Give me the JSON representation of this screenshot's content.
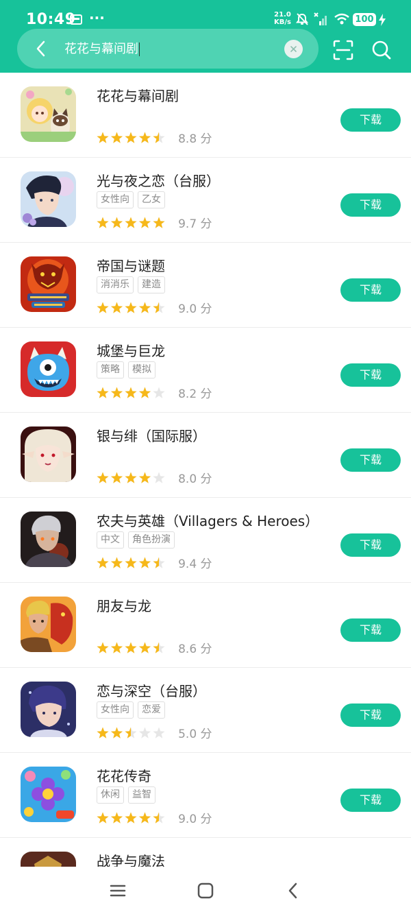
{
  "status_bar": {
    "time": "10:49",
    "more": "···",
    "net_speed_value": "21.0",
    "net_speed_unit": "KB/s",
    "battery": "100"
  },
  "search": {
    "query": "花花与幕间剧"
  },
  "colors": {
    "accent": "#17c29a",
    "search_pill": "#4fd3b3",
    "star_filled": "#f6b81a",
    "star_empty": "#e6e6e6"
  },
  "download_label": "下载",
  "score_unit": "分",
  "apps": [
    {
      "name": "花花与幕间剧",
      "tags": [],
      "rating": 4.5,
      "score": "8.8"
    },
    {
      "name": "光与夜之恋（台服）",
      "tags": [
        "女性向",
        "乙女"
      ],
      "rating": 5,
      "score": "9.7"
    },
    {
      "name": "帝国与谜题",
      "tags": [
        "消消乐",
        "建造"
      ],
      "rating": 4.5,
      "score": "9.0"
    },
    {
      "name": "城堡与巨龙",
      "tags": [
        "策略",
        "模拟"
      ],
      "rating": 4,
      "score": "8.2"
    },
    {
      "name": "银与绯（国际服）",
      "tags": [],
      "rating": 4,
      "score": "8.0"
    },
    {
      "name": "农夫与英雄（Villagers & Heroes）",
      "tags": [
        "中文",
        "角色扮演"
      ],
      "rating": 4.5,
      "score": "9.4"
    },
    {
      "name": "朋友与龙",
      "tags": [],
      "rating": 4.5,
      "score": "8.6"
    },
    {
      "name": "恋与深空（台服）",
      "tags": [
        "女性向",
        "恋爱"
      ],
      "rating": 2.5,
      "score": "5.0"
    },
    {
      "name": "花花传奇",
      "tags": [
        "休闲",
        "益智"
      ],
      "rating": 4.5,
      "score": "9.0"
    },
    {
      "name": "战争与魔法",
      "tags": [],
      "rating": null,
      "score": null
    }
  ]
}
